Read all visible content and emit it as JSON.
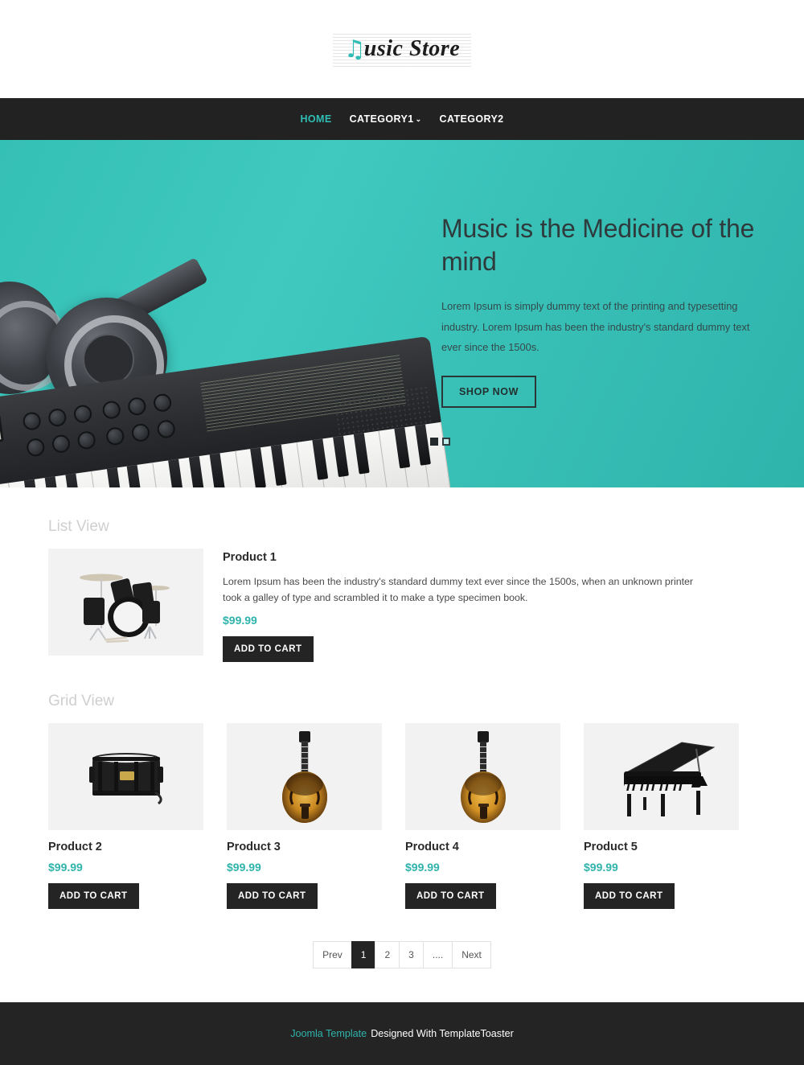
{
  "header": {
    "logo_note_icon": "music-note-icon",
    "logo_text": "usic Store",
    "logo_full": "Music Store"
  },
  "nav": {
    "items": [
      {
        "label": "HOME",
        "active": true,
        "has_dropdown": false
      },
      {
        "label": "CATEGORY1",
        "active": false,
        "has_dropdown": true,
        "caret": "⌄"
      },
      {
        "label": "CATEGORY2",
        "active": false,
        "has_dropdown": false
      }
    ]
  },
  "hero": {
    "title": "Music is the Medicine of the mind",
    "description": "Lorem Ipsum is simply dummy text of the printing and typesetting industry. Lorem Ipsum has been the industry's standard dummy text ever since the 1500s.",
    "cta_label": "SHOP NOW",
    "slides_total": 2,
    "active_slide": 1,
    "background_color": "#36bdb4"
  },
  "list_view": {
    "section_label": "List View",
    "product": {
      "name": "Product 1",
      "description": "Lorem Ipsum has been the industry's standard dummy text ever since the 1500s, when an unknown printer took a galley of type and scrambled it to make a type specimen book.",
      "price": "$99.99",
      "button_label": "ADD TO CART",
      "image": "drum-kit"
    }
  },
  "grid_view": {
    "section_label": "Grid View",
    "products": [
      {
        "name": "Product 2",
        "price": "$99.99",
        "button_label": "ADD TO CART",
        "image": "snare-drum"
      },
      {
        "name": "Product 3",
        "price": "$99.99",
        "button_label": "ADD TO CART",
        "image": "archtop-guitar"
      },
      {
        "name": "Product 4",
        "price": "$99.99",
        "button_label": "ADD TO CART",
        "image": "archtop-guitar"
      },
      {
        "name": "Product 5",
        "price": "$99.99",
        "button_label": "ADD TO CART",
        "image": "grand-piano"
      }
    ]
  },
  "pagination": {
    "items": [
      {
        "label": "Prev",
        "active": false
      },
      {
        "label": "1",
        "active": true
      },
      {
        "label": "2",
        "active": false
      },
      {
        "label": "3",
        "active": false
      },
      {
        "label": "....",
        "active": false
      },
      {
        "label": "Next",
        "active": false
      }
    ]
  },
  "footer": {
    "link_label": "Joomla Template",
    "text": "Designed With TemplateToaster"
  },
  "colors": {
    "accent": "#2fb3ab",
    "hero_bg": "#36bdb4",
    "dark": "#242424",
    "nav_bg": "#222222"
  }
}
